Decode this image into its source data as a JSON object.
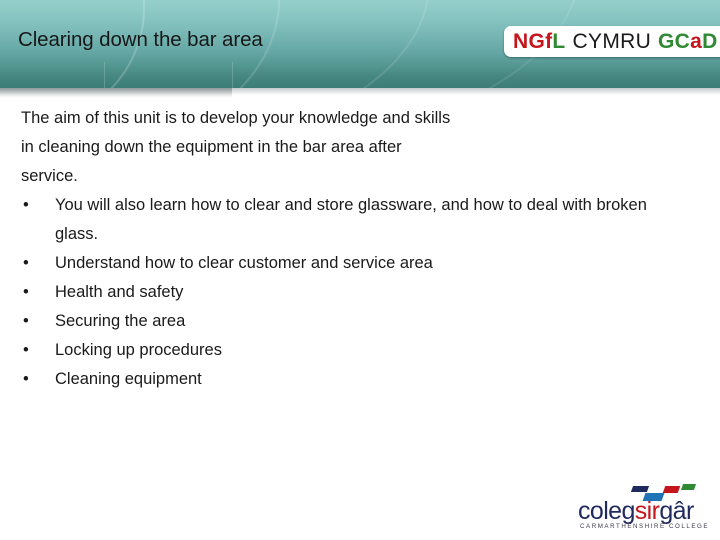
{
  "slide": {
    "title": "Clearing down the bar area",
    "body_paragraph_lines": [
      "The aim of this unit is to develop your knowledge and skills",
      "in cleaning down the equipment in the bar area after",
      "service."
    ],
    "bullet_marker": "•",
    "bullets": [
      "You will also learn how to clear and store glassware, and how to deal with broken glass.",
      "Understand how to clear customer and service area",
      "Health and safety",
      "Securing the area",
      "Locking up procedures",
      "Cleaning equipment"
    ]
  },
  "ngfl_logo": {
    "part1": "NGf",
    "part1b": "L",
    "part2": "CYMRU",
    "part3": "GC",
    "part3b": "a",
    "part3c": "D",
    "colors": {
      "red": "#c4161c",
      "green": "#2f8a33",
      "black": "#1a1a1a"
    }
  },
  "colegsirgar_logo": {
    "word_coleg": "coleg",
    "word_sir": "sir",
    "word_gar": "gâr",
    "subtitle": "CARMARTHENSHIRE COLLEGE",
    "colors": {
      "navy": "#1f2a5e",
      "red": "#c4161c",
      "blue": "#1f74b5",
      "green": "#2f8a33"
    }
  },
  "theme": {
    "band_top": "#95cfcb",
    "band_bottom": "#3c7d78",
    "background": "#ffffff",
    "text": "#1a1a1a"
  }
}
